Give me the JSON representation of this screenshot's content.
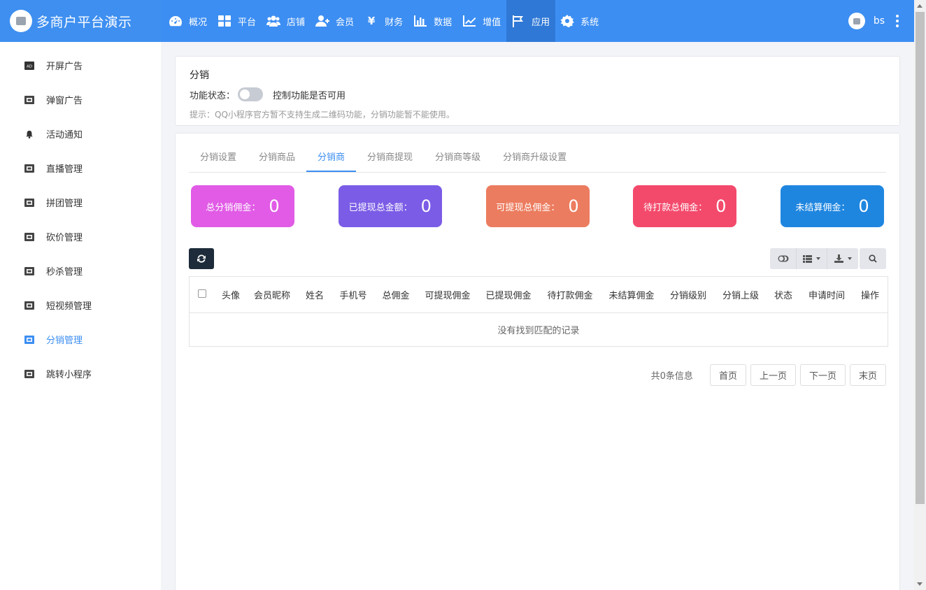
{
  "app": {
    "title": "多商户平台演示"
  },
  "topnav": [
    {
      "label": "概况",
      "icon": "dashboard-icon"
    },
    {
      "label": "平台",
      "icon": "grid-icon"
    },
    {
      "label": "店铺",
      "icon": "users-icon"
    },
    {
      "label": "会员",
      "icon": "user-plus-icon"
    },
    {
      "label": "财务",
      "icon": "yen-icon"
    },
    {
      "label": "数据",
      "icon": "bar-chart-icon"
    },
    {
      "label": "增值",
      "icon": "line-chart-icon"
    },
    {
      "label": "应用",
      "icon": "flag-icon",
      "active": true
    },
    {
      "label": "系统",
      "icon": "gear-icon"
    }
  ],
  "user": {
    "name": "bs"
  },
  "sidebar": [
    {
      "label": "开屏广告"
    },
    {
      "label": "弹窗广告"
    },
    {
      "label": "活动通知"
    },
    {
      "label": "直播管理"
    },
    {
      "label": "拼团管理"
    },
    {
      "label": "砍价管理"
    },
    {
      "label": "秒杀管理"
    },
    {
      "label": "短视频管理"
    },
    {
      "label": "分销管理",
      "active": true
    },
    {
      "label": "跳转小程序"
    }
  ],
  "feature": {
    "title": "分销",
    "status_label": "功能状态：",
    "toggle_desc": "控制功能是否可用",
    "toggle_on": false,
    "hint": "提示：QQ小程序官方暂不支持生成二维码功能，分销功能暂不能使用。"
  },
  "tabs": [
    {
      "label": "分销设置"
    },
    {
      "label": "分销商品"
    },
    {
      "label": "分销商",
      "active": true
    },
    {
      "label": "分销商提现"
    },
    {
      "label": "分销商等级"
    },
    {
      "label": "分销商升级设置"
    }
  ],
  "stats": [
    {
      "label": "总分销佣金：",
      "value": "0",
      "color": "#e15be6"
    },
    {
      "label": "已提现总金额：",
      "value": "0",
      "color": "#7b5ce6"
    },
    {
      "label": "可提现总佣金：",
      "value": "0",
      "color": "#ec7c5f"
    },
    {
      "label": "待打款总佣金：",
      "value": "0",
      "color": "#f34a6c"
    },
    {
      "label": "未结算佣金：",
      "value": "0",
      "color": "#1f86e0"
    }
  ],
  "table": {
    "columns": [
      "头像",
      "会员昵称",
      "姓名",
      "手机号",
      "总佣金",
      "可提现佣金",
      "已提现佣金",
      "待打款佣金",
      "未结算佣金",
      "分销级别",
      "分销上级",
      "状态",
      "申请时间",
      "操作"
    ],
    "empty_text": "没有找到匹配的记录"
  },
  "pager": {
    "total": "共0条信息",
    "first": "首页",
    "prev": "上一页",
    "next": "下一页",
    "last": "末页"
  }
}
